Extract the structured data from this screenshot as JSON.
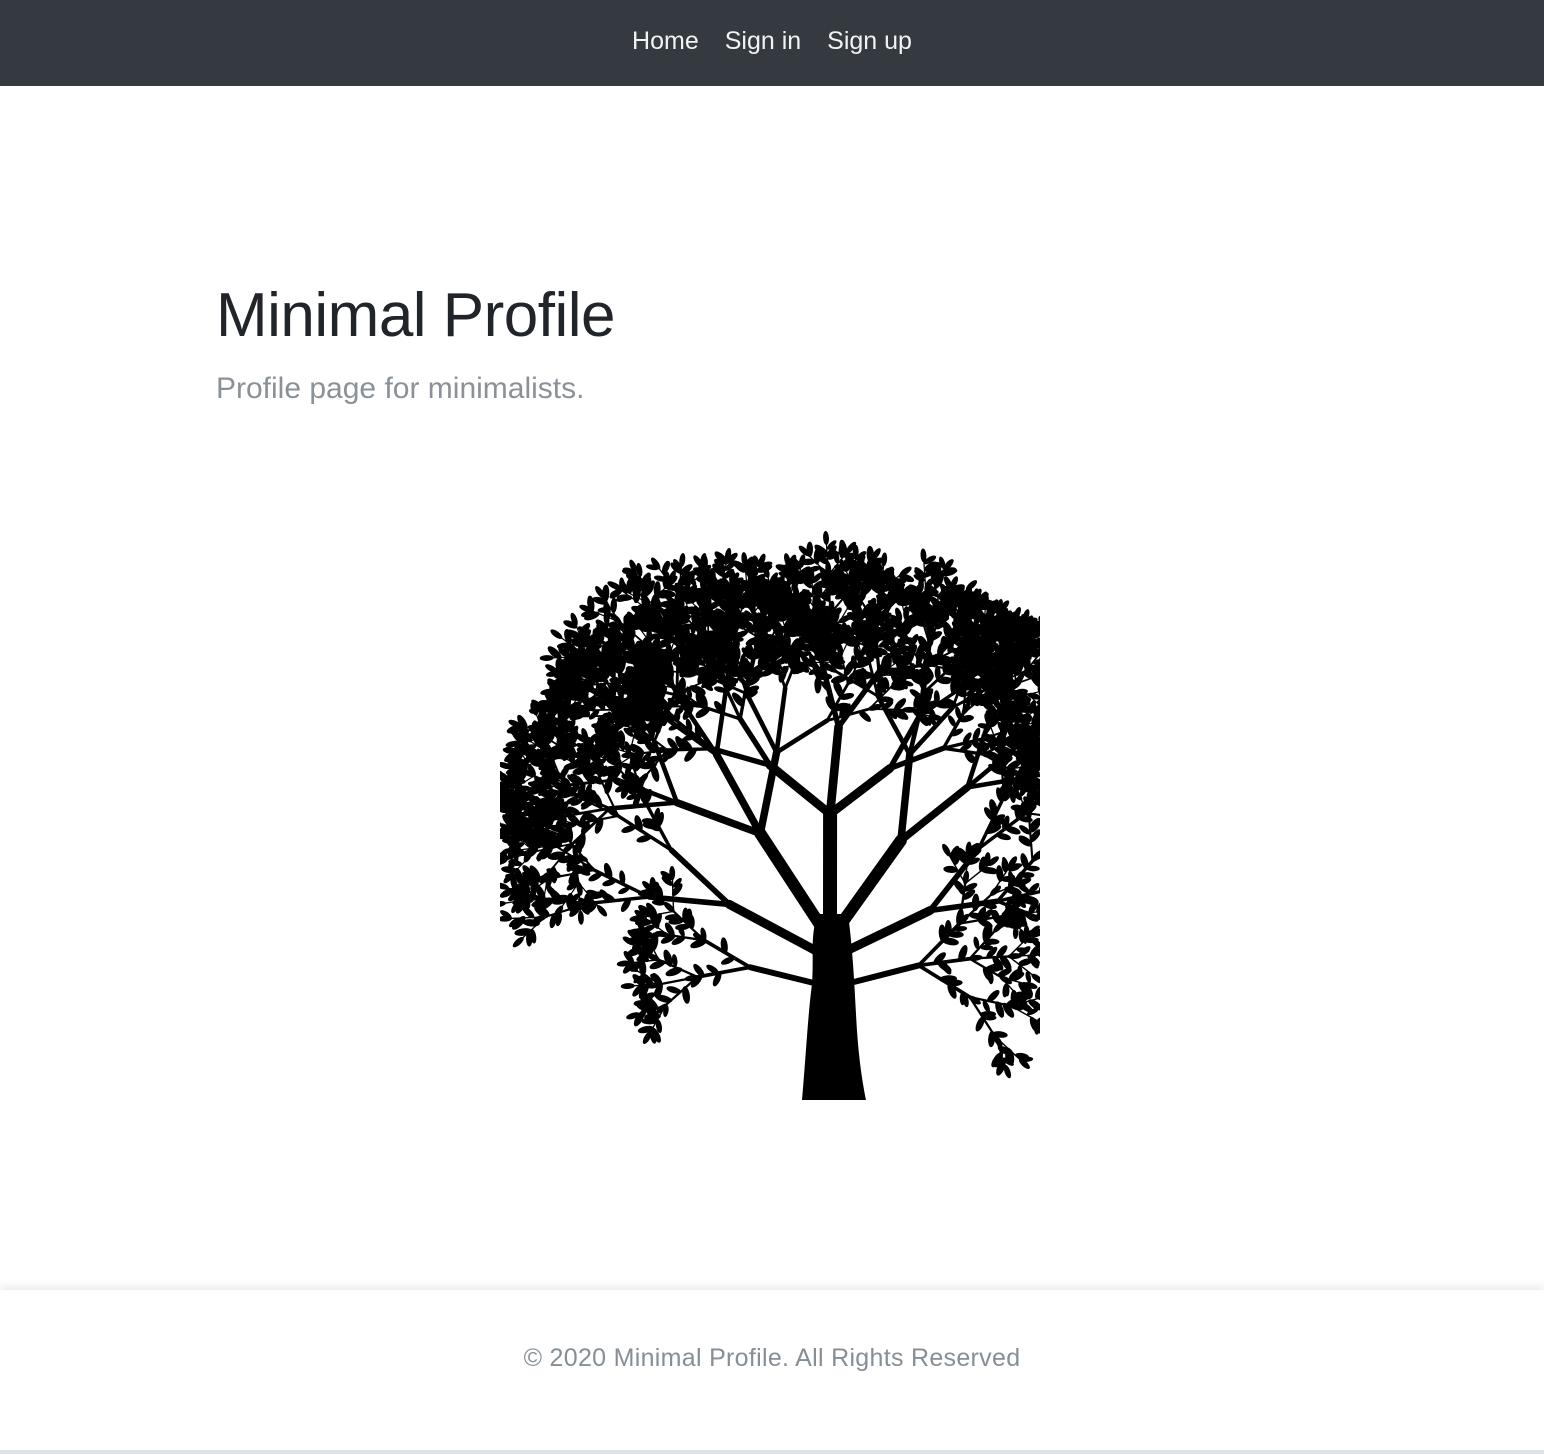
{
  "nav": {
    "items": [
      {
        "label": "Home"
      },
      {
        "label": "Sign in"
      },
      {
        "label": "Sign up"
      }
    ]
  },
  "hero": {
    "title": "Minimal Profile",
    "subtitle": "Profile page for minimalists."
  },
  "illustration": {
    "icon": "tree-silhouette",
    "color": "#000000"
  },
  "footer": {
    "text": "© 2020 Minimal Profile. All Rights Reserved"
  },
  "colors": {
    "navbar_bg": "#343a40",
    "nav_link": "#f2f2f2",
    "title": "#212529",
    "subtitle": "#8a9199",
    "footer_text": "#868e96"
  }
}
